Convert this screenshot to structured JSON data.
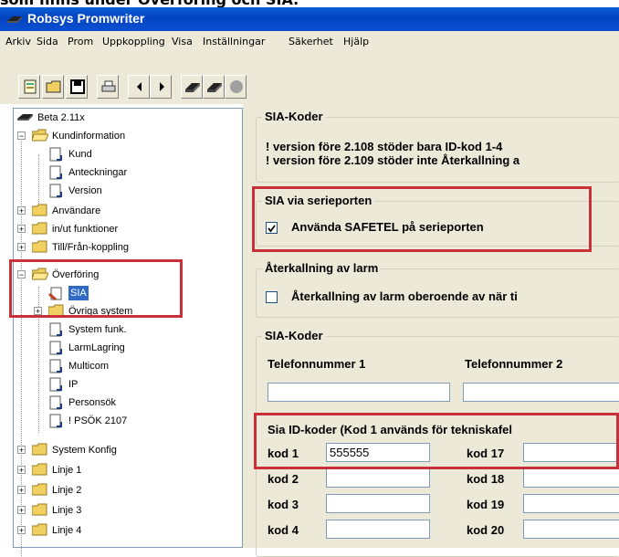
{
  "caption": "som finns under Överföring och SIA.",
  "window": {
    "title": "Robsys Promwriter"
  },
  "menu": [
    "Arkiv",
    "Sida",
    "Prom",
    "Uppkoppling",
    "Visa",
    "Inställningar",
    "Säkerhet",
    "Hjälp"
  ],
  "toolbar": {
    "buttons": [
      "new-icon",
      "open-icon",
      "save-icon",
      "print-icon",
      "back-arrow-icon",
      "forward-arrow-icon",
      "read-icon",
      "write-icon",
      "stop-icon"
    ]
  },
  "tree": {
    "root": "Beta 2.11x",
    "kundinformation": "Kundinformation",
    "kund": "Kund",
    "anteckningar": "Anteckningar",
    "version": "Version",
    "anvandare": "Användare",
    "in_ut": "in/ut funktioner",
    "till_fran": "Till/Från-koppling",
    "overforing": "Överföring",
    "sia": "SIA",
    "ovriga": "Övriga system",
    "system_funk": "System funk.",
    "larmlagring": "LarmLagring",
    "multicom": "Multicom",
    "ip": "IP",
    "personsok": "Personsök",
    "psok": "! PSÖK 2107",
    "system_konfig": "System Konfig",
    "linje1": "Linje 1",
    "linje2": "Linje 2",
    "linje3": "Linje 3",
    "linje4": "Linje 4"
  },
  "panel": {
    "group1_title": "SIA-Koder",
    "note1": "! version före 2.108 stöder bara ID-kod 1-4",
    "note2": "! version före 2.109 stöder inte Återkallning a",
    "serial_title": "SIA via serieporten",
    "serial_checkbox": "Använda SAFETEL på serieporten",
    "serial_checked": true,
    "recall_title": "Återkallning av larm",
    "recall_checkbox": "Återkallning av larm oberoende av när ti",
    "recall_checked": false,
    "codes_title": "SIA-Koder",
    "tel1_label": "Telefonnummer 1",
    "tel2_label": "Telefonnummer 2",
    "tel1_value": "",
    "tel2_value": "",
    "ids_title": "Sia ID-koder  (Kod 1 används för tekniskafel",
    "kod1_label": "kod 1",
    "kod1_value": "555555",
    "kod17_label": "kod 17",
    "kod17_value": "",
    "kod2_label": "kod 2",
    "kod2_value": "",
    "kod18_label": "kod 18",
    "kod18_value": "",
    "kod3_label": "kod 3",
    "kod3_value": "",
    "kod19_label": "kod 19",
    "kod19_value": "",
    "kod4_label": "kod 4",
    "kod4_value": "",
    "kod20_label": "kod 20",
    "kod20_value": ""
  },
  "colors": {
    "title_bar": "#0344c0",
    "highlight": "#c8303a",
    "selection": "#316ac5",
    "face": "#ece9d8"
  }
}
